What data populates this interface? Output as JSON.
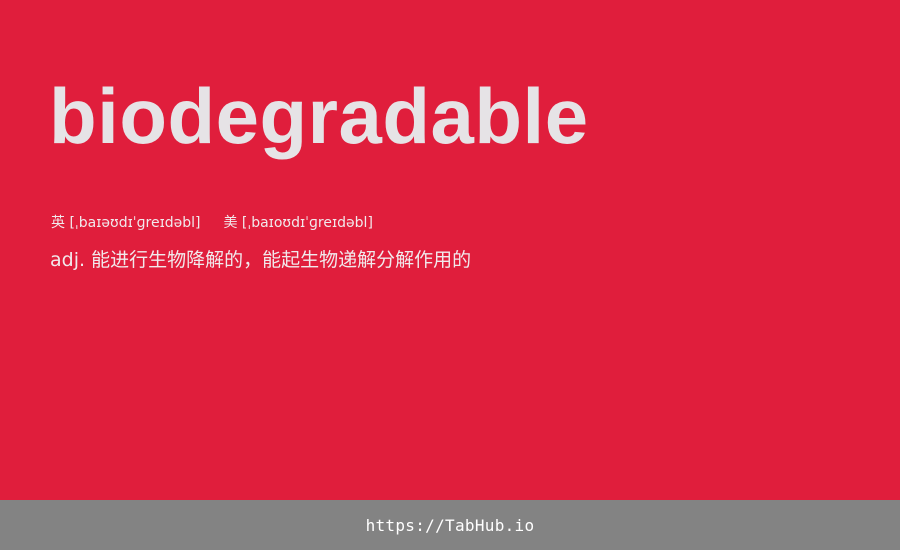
{
  "word": "biodegradable",
  "pronunciation": {
    "uk_label": "英",
    "uk_ipa": "[ˌbaɪəʊdɪˈɡreɪdəbl]",
    "us_label": "美",
    "us_ipa": "[ˌbaɪoʊdɪˈɡreɪdəbl]"
  },
  "definition": {
    "pos": "adj.",
    "meaning": "能进行生物降解的，能起生物递解分解作用的"
  },
  "footer": {
    "link": "https://TabHub.io"
  },
  "colors": {
    "background": "#e01e3c",
    "footer_background": "#838383",
    "word_text": "#e6e3e6"
  }
}
